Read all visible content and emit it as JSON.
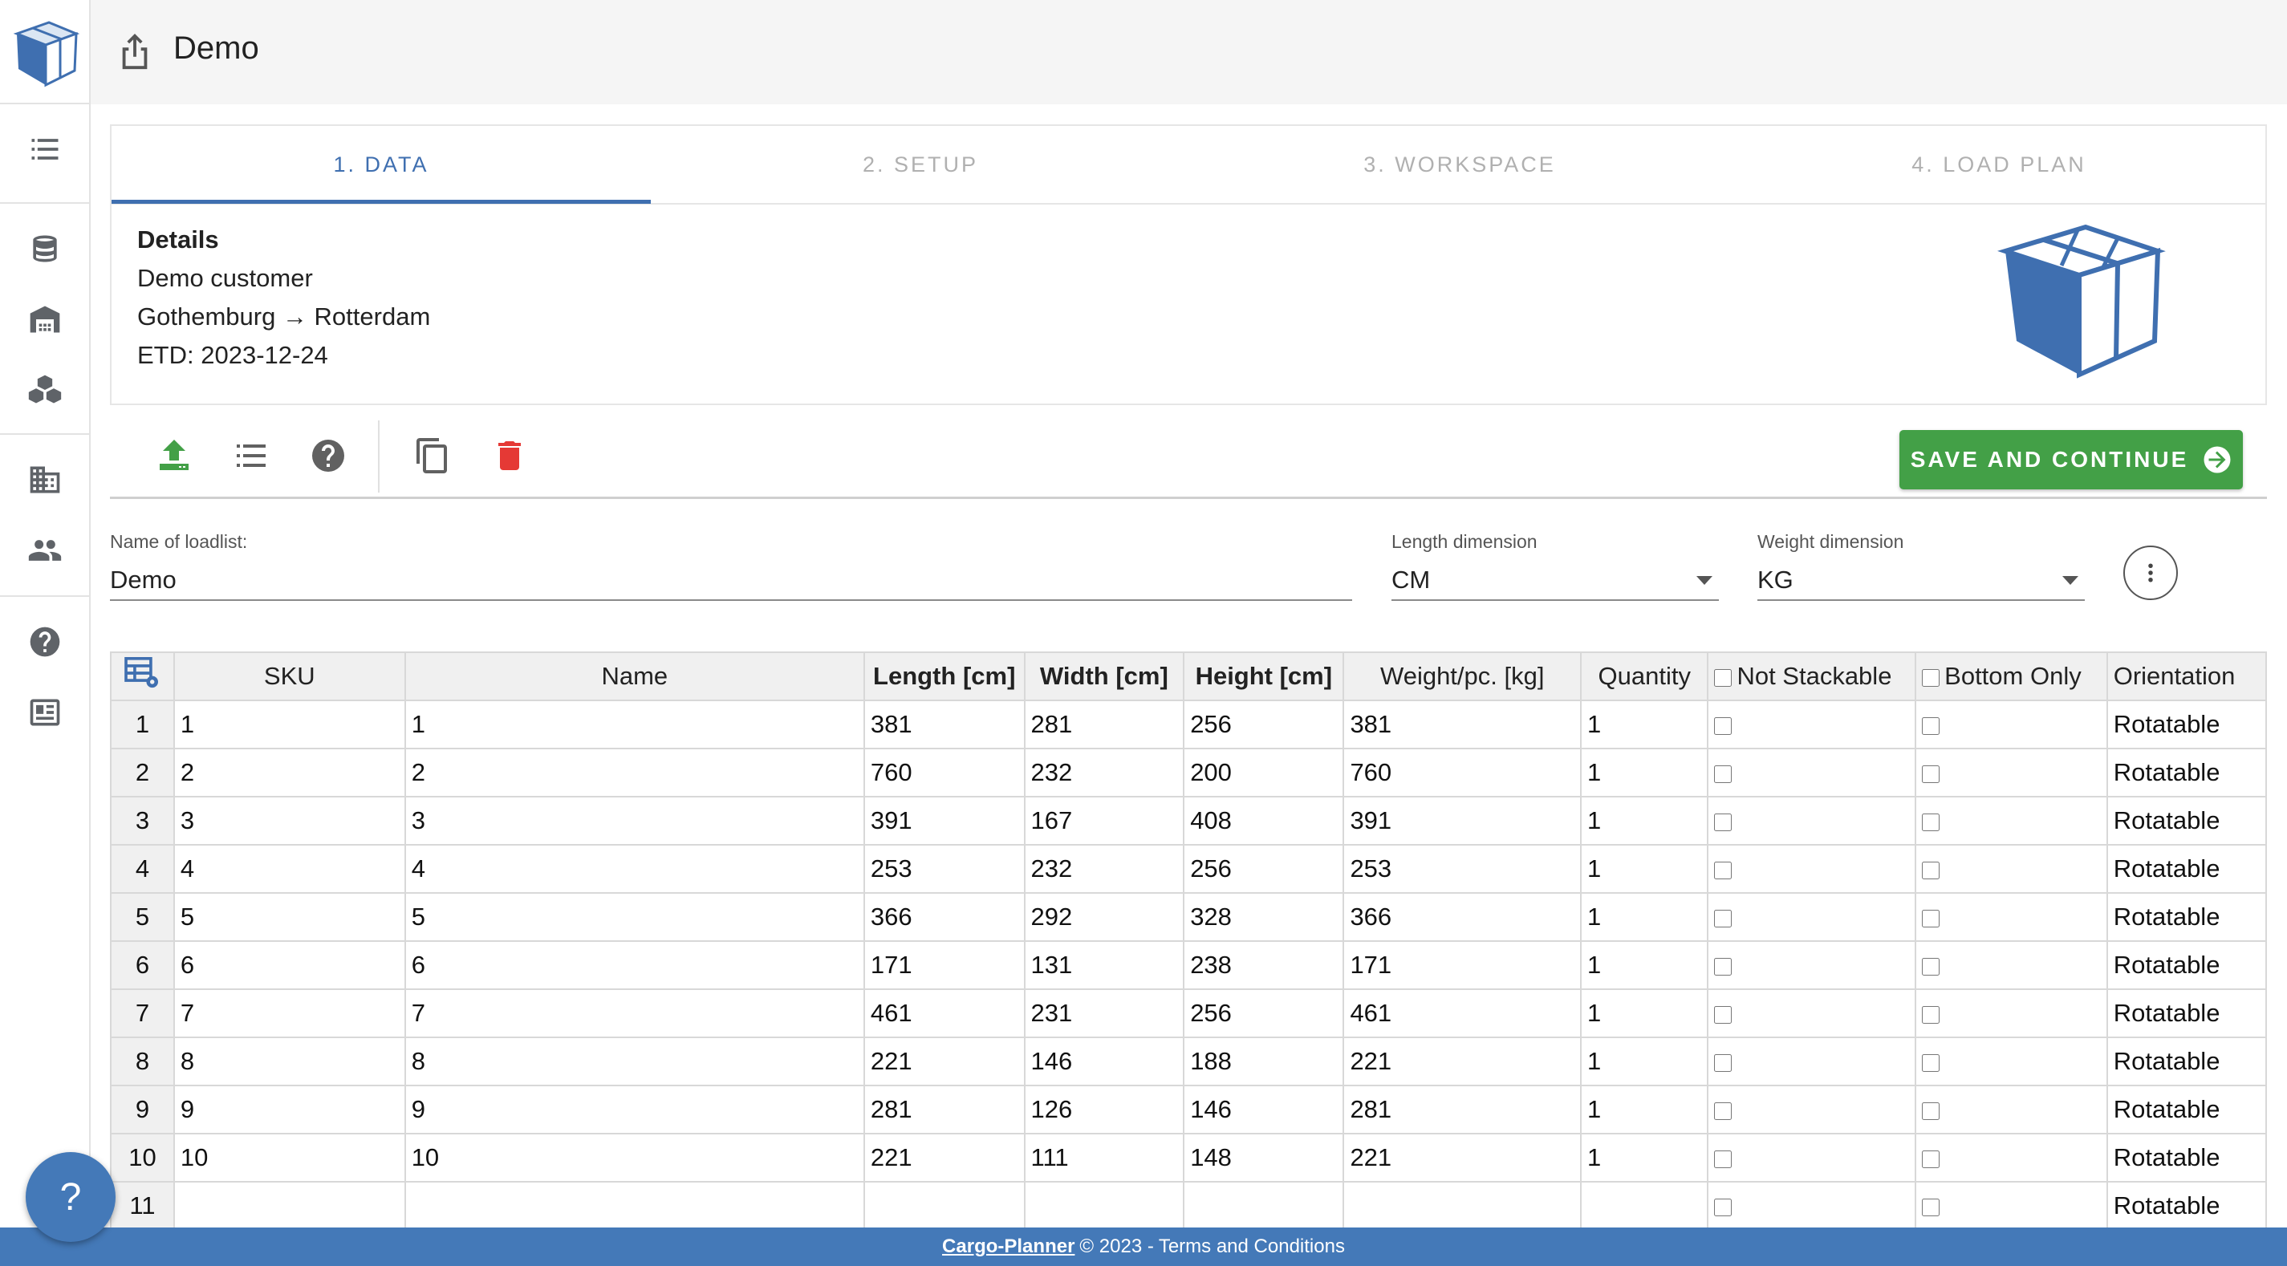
{
  "app": {
    "title": "Demo"
  },
  "rail": {
    "items": [
      "list-icon",
      "database-icon",
      "warehouse-icon",
      "boxes-icon",
      "building-icon",
      "people-icon",
      "help-icon",
      "news-icon"
    ]
  },
  "tabs": [
    {
      "label": "1. DATA",
      "active": true
    },
    {
      "label": "2. SETUP",
      "active": false
    },
    {
      "label": "3. WORKSPACE",
      "active": false
    },
    {
      "label": "4. LOAD PLAN",
      "active": false
    }
  ],
  "details": {
    "heading": "Details",
    "customer": "Demo customer",
    "route": "Gothemburg → Rotterdam",
    "etd": "ETD: 2023-12-24"
  },
  "toolbar": {
    "icons": [
      "upload-icon",
      "list-icon",
      "help-icon",
      "copy-icon",
      "delete-icon"
    ],
    "save_label": "SAVE AND CONTINUE"
  },
  "form": {
    "name_label": "Name of loadlist:",
    "name_value": "Demo",
    "length_label": "Length dimension",
    "length_value": "CM",
    "weight_label": "Weight dimension",
    "weight_value": "KG"
  },
  "table": {
    "headers": [
      "SKU",
      "Name",
      "Length [cm]",
      "Width [cm]",
      "Height [cm]",
      "Weight/pc. [kg]",
      "Quantity",
      "Not Stackable",
      "Bottom Only",
      "Orientation"
    ],
    "rows": [
      [
        "1",
        "1",
        "1",
        "381",
        "281",
        "256",
        "381",
        "1",
        "Rotatable"
      ],
      [
        "2",
        "2",
        "2",
        "760",
        "232",
        "200",
        "760",
        "1",
        "Rotatable"
      ],
      [
        "3",
        "3",
        "3",
        "391",
        "167",
        "408",
        "391",
        "1",
        "Rotatable"
      ],
      [
        "4",
        "4",
        "4",
        "253",
        "232",
        "256",
        "253",
        "1",
        "Rotatable"
      ],
      [
        "5",
        "5",
        "5",
        "366",
        "292",
        "328",
        "366",
        "1",
        "Rotatable"
      ],
      [
        "6",
        "6",
        "6",
        "171",
        "131",
        "238",
        "171",
        "1",
        "Rotatable"
      ],
      [
        "7",
        "7",
        "7",
        "461",
        "231",
        "256",
        "461",
        "1",
        "Rotatable"
      ],
      [
        "8",
        "8",
        "8",
        "221",
        "146",
        "188",
        "221",
        "1",
        "Rotatable"
      ],
      [
        "9",
        "9",
        "9",
        "281",
        "126",
        "146",
        "281",
        "1",
        "Rotatable"
      ],
      [
        "10",
        "10",
        "10",
        "221",
        "111",
        "148",
        "221",
        "1",
        "Rotatable"
      ],
      [
        "11",
        "",
        "",
        "",
        "",
        "",
        "",
        "",
        "Rotatable"
      ]
    ]
  },
  "footer": {
    "brand": "Cargo-Planner",
    "copyright": "© 2023 -",
    "terms": "Terms and Conditions"
  },
  "fab": {
    "label": "?"
  },
  "colors": {
    "accent": "#4479b8",
    "save": "#43a047",
    "delete": "#e53935"
  }
}
